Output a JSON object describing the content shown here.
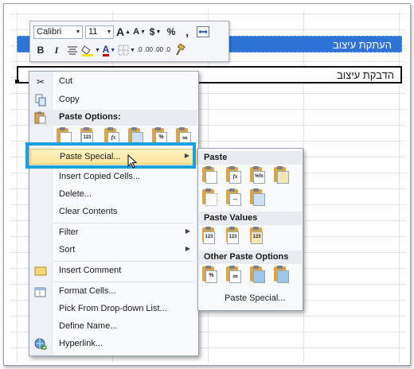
{
  "sheet": {
    "copied_cell_text": "העתקת עיצוב",
    "target_cell_text": "הדבקת עיצוב"
  },
  "mini_toolbar": {
    "font_name": "Calibri",
    "font_size": "11",
    "grow_font": "A",
    "shrink_font": "A",
    "currency": "$",
    "percent": "%",
    "comma": ",",
    "bold": "B",
    "italic": "I",
    "increase_decimal": ".0 .00",
    "decrease_decimal": ".00 .0"
  },
  "context_menu": {
    "cut": "Cut",
    "copy": "Copy",
    "paste_options": "Paste Options:",
    "paste_special": "Paste Special...",
    "insert_copied_cells": "Insert Copied Cells...",
    "delete": "Delete...",
    "clear_contents": "Clear Contents",
    "filter": "Filter",
    "sort": "Sort",
    "insert_comment": "Insert Comment",
    "format_cells": "Format Cells...",
    "pick_from_list": "Pick From Drop-down List...",
    "define_name": "Define Name...",
    "hyperlink": "Hyperlink...",
    "paste_icons": [
      "",
      "123",
      "fx",
      "",
      "%",
      ""
    ]
  },
  "submenu": {
    "paste": "Paste",
    "paste_values": "Paste Values",
    "other_paste_options": "Other Paste Options",
    "paste_special": "Paste Special...",
    "value_icons": [
      "123",
      "123",
      "123"
    ]
  },
  "colors": {
    "selection_blue": "#2d74d6",
    "annotation_cyan": "#1aa0dc",
    "hover_gold": "#fde69a"
  }
}
